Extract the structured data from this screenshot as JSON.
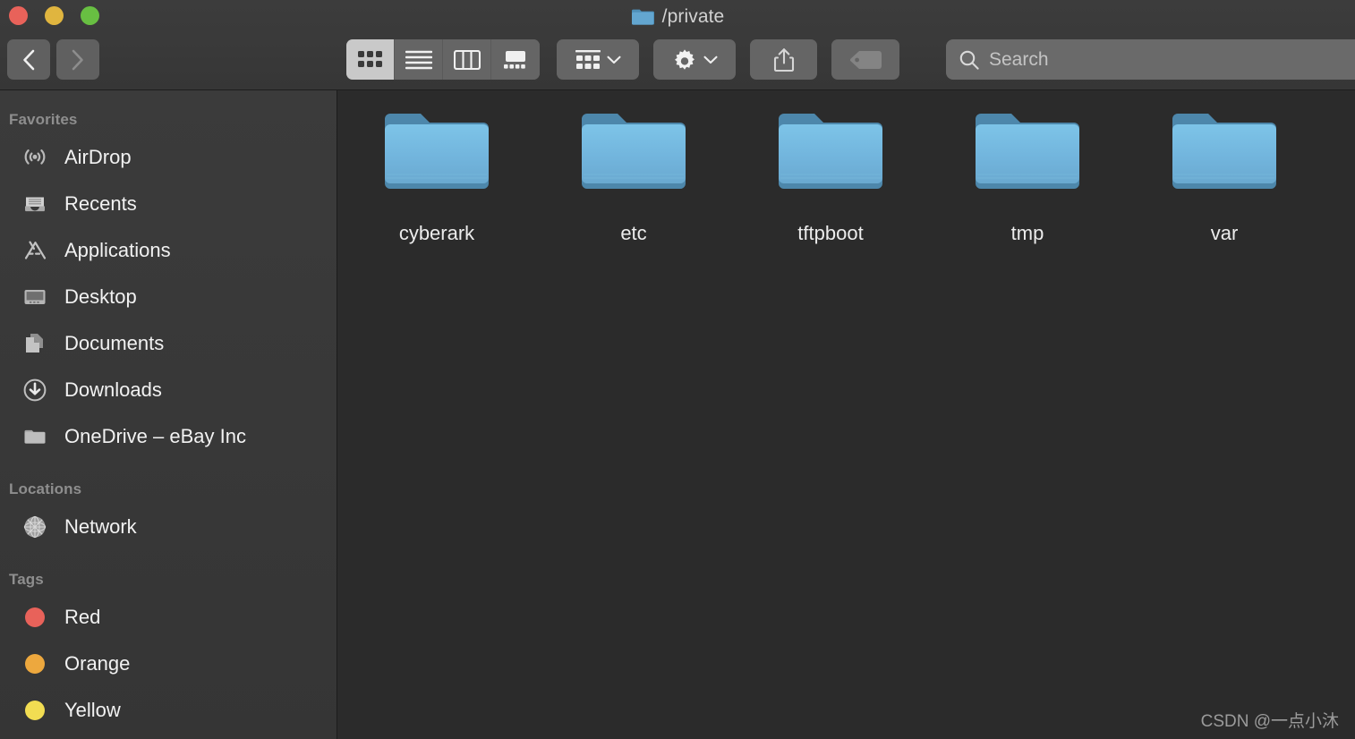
{
  "window": {
    "title": "/private",
    "title_icon": "folder-icon",
    "traffic_lights": [
      {
        "name": "close-button",
        "color": "#e8625a"
      },
      {
        "name": "minimize-button",
        "color": "#e0b53f"
      },
      {
        "name": "maximize-button",
        "color": "#68bf42"
      }
    ]
  },
  "toolbar": {
    "back_label": "Back",
    "forward_label": "Forward",
    "view_modes": [
      {
        "name": "icon-view",
        "label": "Icon View",
        "active": true
      },
      {
        "name": "list-view",
        "label": "List View",
        "active": false
      },
      {
        "name": "column-view",
        "label": "Column View",
        "active": false
      },
      {
        "name": "gallery-view",
        "label": "Gallery View",
        "active": false
      }
    ],
    "group_by_label": "Group By",
    "action_label": "Action",
    "share_label": "Share",
    "tags_label": "Tags"
  },
  "search": {
    "placeholder": "Search",
    "value": ""
  },
  "sidebar": {
    "sections": [
      {
        "title": "Favorites",
        "items": [
          {
            "label": "AirDrop",
            "icon": "airdrop-icon"
          },
          {
            "label": "Recents",
            "icon": "recents-icon"
          },
          {
            "label": "Applications",
            "icon": "applications-icon"
          },
          {
            "label": "Desktop",
            "icon": "desktop-icon"
          },
          {
            "label": "Documents",
            "icon": "documents-icon"
          },
          {
            "label": "Downloads",
            "icon": "downloads-icon"
          },
          {
            "label": "OneDrive – eBay Inc",
            "icon": "folder-icon"
          }
        ]
      },
      {
        "title": "Locations",
        "items": [
          {
            "label": "Network",
            "icon": "network-icon"
          }
        ]
      },
      {
        "title": "Tags",
        "items": [
          {
            "label": "Red",
            "icon": "tag-dot",
            "color": "#e8625a"
          },
          {
            "label": "Orange",
            "icon": "tag-dot",
            "color": "#eda83e"
          },
          {
            "label": "Yellow",
            "icon": "tag-dot",
            "color": "#f2dd52"
          }
        ]
      }
    ]
  },
  "content": {
    "items": [
      {
        "label": "cyberark",
        "icon": "folder-icon"
      },
      {
        "label": "etc",
        "icon": "folder-icon"
      },
      {
        "label": "tftpboot",
        "icon": "folder-icon"
      },
      {
        "label": "tmp",
        "icon": "folder-icon"
      },
      {
        "label": "var",
        "icon": "folder-icon"
      }
    ]
  },
  "watermark": {
    "text": "CSDN @一点小沐"
  }
}
